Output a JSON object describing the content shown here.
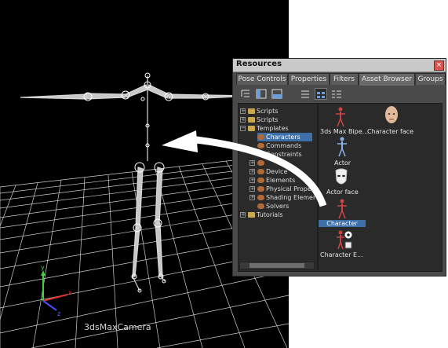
{
  "viewport": {
    "camera_label": "3dsMaxCamera",
    "axis_labels": {
      "x": "x",
      "y": "y",
      "z": "z"
    }
  },
  "window": {
    "title": "Resources",
    "close_glyph": "×",
    "tabs": [
      "Pose Controls",
      "Properties",
      "Filters",
      "Asset Browser",
      "Groups"
    ],
    "active_tab": "Asset Browser"
  },
  "tree": {
    "items": [
      {
        "label": "Scripts",
        "level": 0,
        "expander": "+",
        "icon": "folder-icon"
      },
      {
        "label": "Scripts",
        "level": 0,
        "expander": "+",
        "icon": "folder-icon"
      },
      {
        "label": "Templates",
        "level": 0,
        "expander": "−",
        "icon": "folder-icon"
      },
      {
        "label": "Characters",
        "level": 1,
        "expander": "",
        "icon": "character-icon",
        "selected": true
      },
      {
        "label": "Commands",
        "level": 1,
        "expander": "",
        "icon": "character-icon"
      },
      {
        "label": "Constraints",
        "level": 1,
        "expander": "",
        "icon": "character-icon"
      },
      {
        "label": "",
        "level": 1,
        "expander": "+",
        "icon": "character-icon"
      },
      {
        "label": "Device",
        "level": 1,
        "expander": "+",
        "icon": "character-icon"
      },
      {
        "label": "Elements",
        "level": 1,
        "expander": "+",
        "icon": "character-icon"
      },
      {
        "label": "Physical Proper",
        "level": 1,
        "expander": "+",
        "icon": "character-icon"
      },
      {
        "label": "Shading Elemer",
        "level": 1,
        "expander": "+",
        "icon": "character-icon"
      },
      {
        "label": "Solvers",
        "level": 1,
        "expander": "",
        "icon": "character-icon"
      },
      {
        "label": "Tutorials",
        "level": 0,
        "expander": "+",
        "icon": "folder-icon"
      }
    ]
  },
  "assets": {
    "items": [
      {
        "label": "3ds Max Bipe...",
        "icon": "biped-icon"
      },
      {
        "label": "Character face",
        "icon": "character-face-icon"
      },
      {
        "label": "Actor",
        "icon": "actor-icon"
      },
      {
        "label": "Actor face",
        "icon": "actor-face-icon"
      },
      {
        "label": "Character",
        "icon": "character-icon",
        "selected": true
      },
      {
        "label": "Character E...",
        "icon": "character-extension-icon"
      }
    ]
  },
  "colors": {
    "selection": "#3d6fa8",
    "panel": "#4a4a4a",
    "list_bg": "#2a2a2a",
    "grid": "#cfcfcf"
  }
}
